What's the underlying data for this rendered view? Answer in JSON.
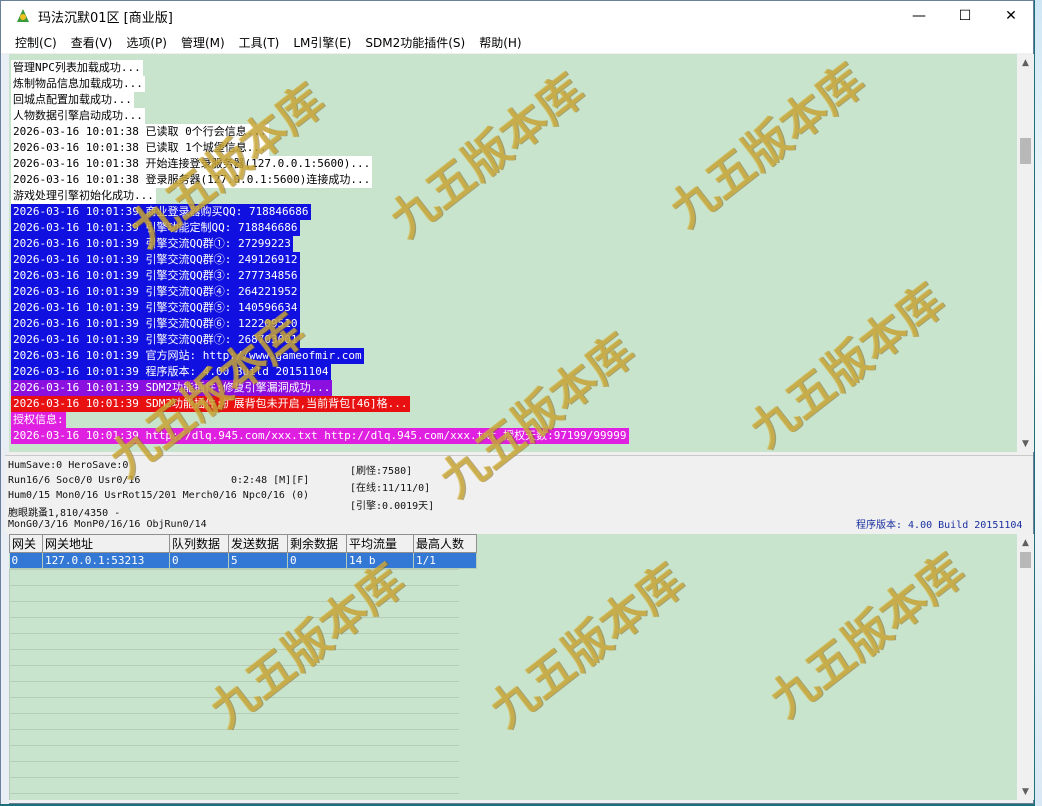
{
  "window": {
    "title": "玛法沉默01区 [商业版]",
    "controls": {
      "minimize": "—",
      "maximize": "☐",
      "close": "✕"
    }
  },
  "menu": [
    "控制(C)",
    "查看(V)",
    "选项(P)",
    "管理(M)",
    "工具(T)",
    "LM引擎(E)",
    "SDM2功能插件(S)",
    "帮助(H)"
  ],
  "log": [
    {
      "text": "管理NPC列表加载成功...",
      "bg": "#ffffff",
      "fg": "#000000"
    },
    {
      "text": "炼制物品信息加载成功...",
      "bg": "#ffffff",
      "fg": "#000000"
    },
    {
      "text": "回城点配置加载成功...",
      "bg": "#ffffff",
      "fg": "#000000"
    },
    {
      "text": "人物数据引擎启动成功...",
      "bg": "#ffffff",
      "fg": "#000000"
    },
    {
      "text": "2026-03-16 10:01:38 已读取 0个行会信息...",
      "bg": "#ffffff",
      "fg": "#000000"
    },
    {
      "text": "2026-03-16 10:01:38 已读取 1个城堡信息...",
      "bg": "#ffffff",
      "fg": "#000000"
    },
    {
      "text": "2026-03-16 10:01:38 开始连接登录服务器(127.0.0.1:5600)...",
      "bg": "#ffffff",
      "fg": "#000000"
    },
    {
      "text": "2026-03-16 10:01:38 登录服务器(127.0.0.1:5600)连接成功...",
      "bg": "#ffffff",
      "fg": "#000000"
    },
    {
      "text": "游戏处理引擎初始化成功...",
      "bg": "#ffffff",
      "fg": "#000000"
    },
    {
      "text": "2026-03-16 10:01:39 商业登录器购买QQ: 718846686",
      "bg": "#1010e0",
      "fg": "#ffffff"
    },
    {
      "text": "2026-03-16 10:01:39 引擎功能定制QQ: 718846686",
      "bg": "#1010e0",
      "fg": "#ffffff"
    },
    {
      "text": "2026-03-16 10:01:39 引擎交流QQ群①: 27299223",
      "bg": "#1010e0",
      "fg": "#ffffff"
    },
    {
      "text": "2026-03-16 10:01:39 引擎交流QQ群②: 249126912",
      "bg": "#1010e0",
      "fg": "#ffffff"
    },
    {
      "text": "2026-03-16 10:01:39 引擎交流QQ群③: 277734856",
      "bg": "#1010e0",
      "fg": "#ffffff"
    },
    {
      "text": "2026-03-16 10:01:39 引擎交流QQ群④: 264221952",
      "bg": "#1010e0",
      "fg": "#ffffff"
    },
    {
      "text": "2026-03-16 10:01:39 引擎交流QQ群⑤: 140596634",
      "bg": "#1010e0",
      "fg": "#ffffff"
    },
    {
      "text": "2026-03-16 10:01:39 引擎交流QQ群⑥: 122209510",
      "bg": "#1010e0",
      "fg": "#ffffff"
    },
    {
      "text": "2026-03-16 10:01:39 引擎交流QQ群⑦: 268703001",
      "bg": "#1010e0",
      "fg": "#ffffff"
    },
    {
      "text": "2026-03-16 10:01:39 官方网站: http://www.gameofmir.com",
      "bg": "#1010e0",
      "fg": "#ffffff"
    },
    {
      "text": "2026-03-16 10:01:39 程序版本: 4.00 Build 20151104",
      "bg": "#1010e0",
      "fg": "#ffffff"
    },
    {
      "text": "2026-03-16 10:01:39 SDM2功能插件:修复引擎漏洞成功...",
      "bg": "#8b10e0",
      "fg": "#ffffff"
    },
    {
      "text": "2026-03-16 10:01:39 SDM2功能插件:扩展背包未开启,当前背包[46]格...",
      "bg": "#e81010",
      "fg": "#ffffff"
    },
    {
      "text": "授权信息:",
      "bg": "#e020e0",
      "fg": "#ffffff"
    },
    {
      "text": "2026-03-16 10:01:39 http://dlq.945.com/xxx.txt http://dlq.945.com/xxx.txt 授权天数:97199/99999",
      "bg": "#e020e0",
      "fg": "#ffffff"
    }
  ],
  "status": {
    "line1": "HumSave:0 HeroSave:0",
    "line2a": "Run16/6 Soc0/0 Usr0/16",
    "line2b": "0:2:48 [M][F]",
    "line3": "Hum0/15 Mon0/16 UsrRot15/201 Merch0/16 Npc0/16 (0)",
    "line4": "胞眼跳蚤1,810/4350 -",
    "line5": "MonG0/3/16 MonP0/16/16 ObjRun0/14",
    "refresh": "[刷怪:7580]",
    "online": "[在线:11/11/0]",
    "engine": "[引擎:0.0019天]",
    "version": "程序版本: 4.00 Build 20151104"
  },
  "grid": {
    "headers": [
      "网关",
      "网关地址",
      "队列数据",
      "发送数据",
      "剩余数据",
      "平均流量",
      "最高人数"
    ],
    "rows": [
      [
        "0",
        "127.0.0.1:53213",
        "0",
        "5",
        "0",
        "14 b",
        "1/1"
      ]
    ]
  },
  "watermark": {
    "text": "九五版本库",
    "url": "www.95bbk.com"
  },
  "colors": {
    "log_bg": "#c8e4cc",
    "selection": "#3478d6"
  }
}
